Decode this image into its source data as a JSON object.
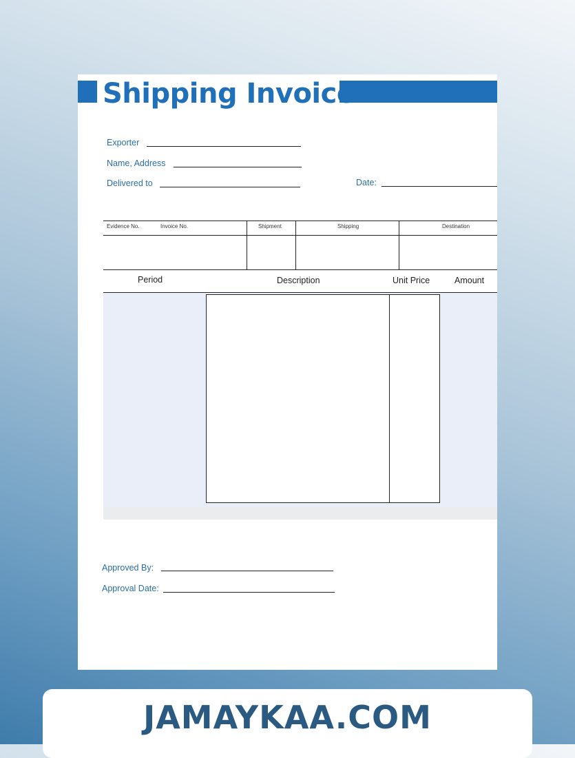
{
  "document": {
    "title": "Shipping Invoice",
    "fields": {
      "exporter": "Exporter",
      "name_address": "Name, Address",
      "delivered_to": "Delivered to",
      "date": "Date:"
    },
    "shipment_table": {
      "headers": [
        "Evidence No.",
        "Invoice No.",
        "Shipment",
        "Shipping",
        "Destination"
      ]
    },
    "item_table": {
      "headers": [
        "Period",
        "Description",
        "Unit Price",
        "Amount"
      ]
    },
    "approval": {
      "approved_by": "Approved By:",
      "approval_date": "Approval Date:"
    }
  },
  "banner": {
    "text": "JAMAYKAA.COM"
  },
  "colors": {
    "accent": "#1f6fb9",
    "label": "#2b6ea8",
    "shade": "#e9eef9",
    "banner_text": "#2a5a82"
  }
}
